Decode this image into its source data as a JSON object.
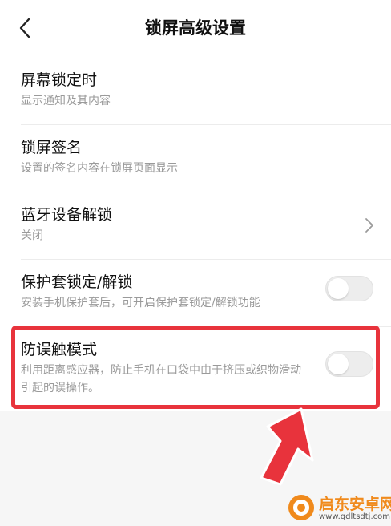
{
  "header": {
    "title": "锁屏高级设置",
    "back_icon": "chevron-left-icon"
  },
  "settings": {
    "items": [
      {
        "title": "屏幕锁定时",
        "subtitle": "显示通知及其内容"
      },
      {
        "title": "锁屏签名",
        "subtitle": "设置的签名内容在锁屏页面显示"
      },
      {
        "title": "蓝牙设备解锁",
        "subtitle": "关闭",
        "accessory_icon": "chevron-right-icon"
      },
      {
        "title": "保护套锁定/解锁",
        "subtitle": "安装手机保护套后，可开启保护套锁定/解锁功能",
        "toggle_on": false
      },
      {
        "title": "防误触模式",
        "subtitle": "利用距离感应器，防止手机在口袋中由于挤压或织物滑动引起的误操作。",
        "toggle_on": false
      }
    ]
  },
  "annotation": {
    "highlight_color": "#e8333c",
    "arrow_color": "#e8333c"
  },
  "watermark": {
    "name": "启东安卓网",
    "url": "www.qdltsdtj.com"
  }
}
